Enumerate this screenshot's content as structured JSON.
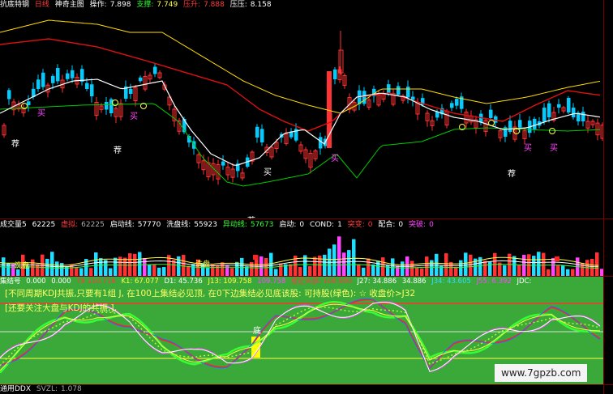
{
  "main_header": {
    "title": "抗底特钢",
    "line": "日线",
    "indicator": "神奇主图",
    "op_label": "操作:",
    "op_value": "7.898",
    "support_label": "支撑:",
    "support_value": "7.749",
    "pressure_label": "压升:",
    "pressure_value": "7.888",
    "resist_label": "压压:",
    "resist_value": "8.158"
  },
  "markers": {
    "buy": "买",
    "recommend": "荐",
    "bottom": "底"
  },
  "volume_header": {
    "title": "成交量5",
    "v1": "62225",
    "virtual_label": "虚拟:",
    "virtual_value": "62225",
    "start_line_label": "启动线:",
    "start_line_value": "57770",
    "wash_line_label": "洗盘线:",
    "wash_line_value": "55923",
    "abnormal_label": "异动线:",
    "abnormal_value": "57673",
    "start_label": "启动:",
    "start_value": "0",
    "cond_label": "COND:",
    "cond_value": "1",
    "sudden_label": "突变:",
    "sudden_value": "0",
    "match_label": "配合:",
    "match_value": "0",
    "break_label": "突破:",
    "break_value": "0"
  },
  "volume_labels": {
    "left": "洗盘",
    "mid": "洗盘"
  },
  "lower_header": {
    "title": "集结号",
    "a": "0.000",
    "b": "0.000",
    "t9": "T9 110.716",
    "k1": "K1: 67.077",
    "d1": "D1: 45.736",
    "j13": "J13: 109.758",
    "j14": "109.758",
    "near": "接近头部: 100.000",
    "j27": "J27: 34.886",
    "j28": "34.886",
    "j34": "J34: 43.605",
    "j55": "J55: 6.392",
    "jdc": "JDC:"
  },
  "notes": {
    "line1": "[不同周期KDJ共振,只要有1组 J, 在100上集结必见顶, 在0下边集结必见底该股: 可持股(绿色): ☆  收盘价>J32",
    "line2": "[还要关注大盘与KDJ的共振,],"
  },
  "bottom_header": {
    "title": "通用DDX",
    "svzl_label": "SVZL:",
    "svzl_value": "1.078"
  },
  "watermark": "www.7gpzb.com",
  "colors": {
    "background": "#000000",
    "up": "#ff3333",
    "down": "#00ccff",
    "ma_white": "#ffffff",
    "ma_yellow": "#ffdd00",
    "ma_green": "#00cc00",
    "ma_red": "#dd1111",
    "panel_green": "#3aa93a"
  }
}
